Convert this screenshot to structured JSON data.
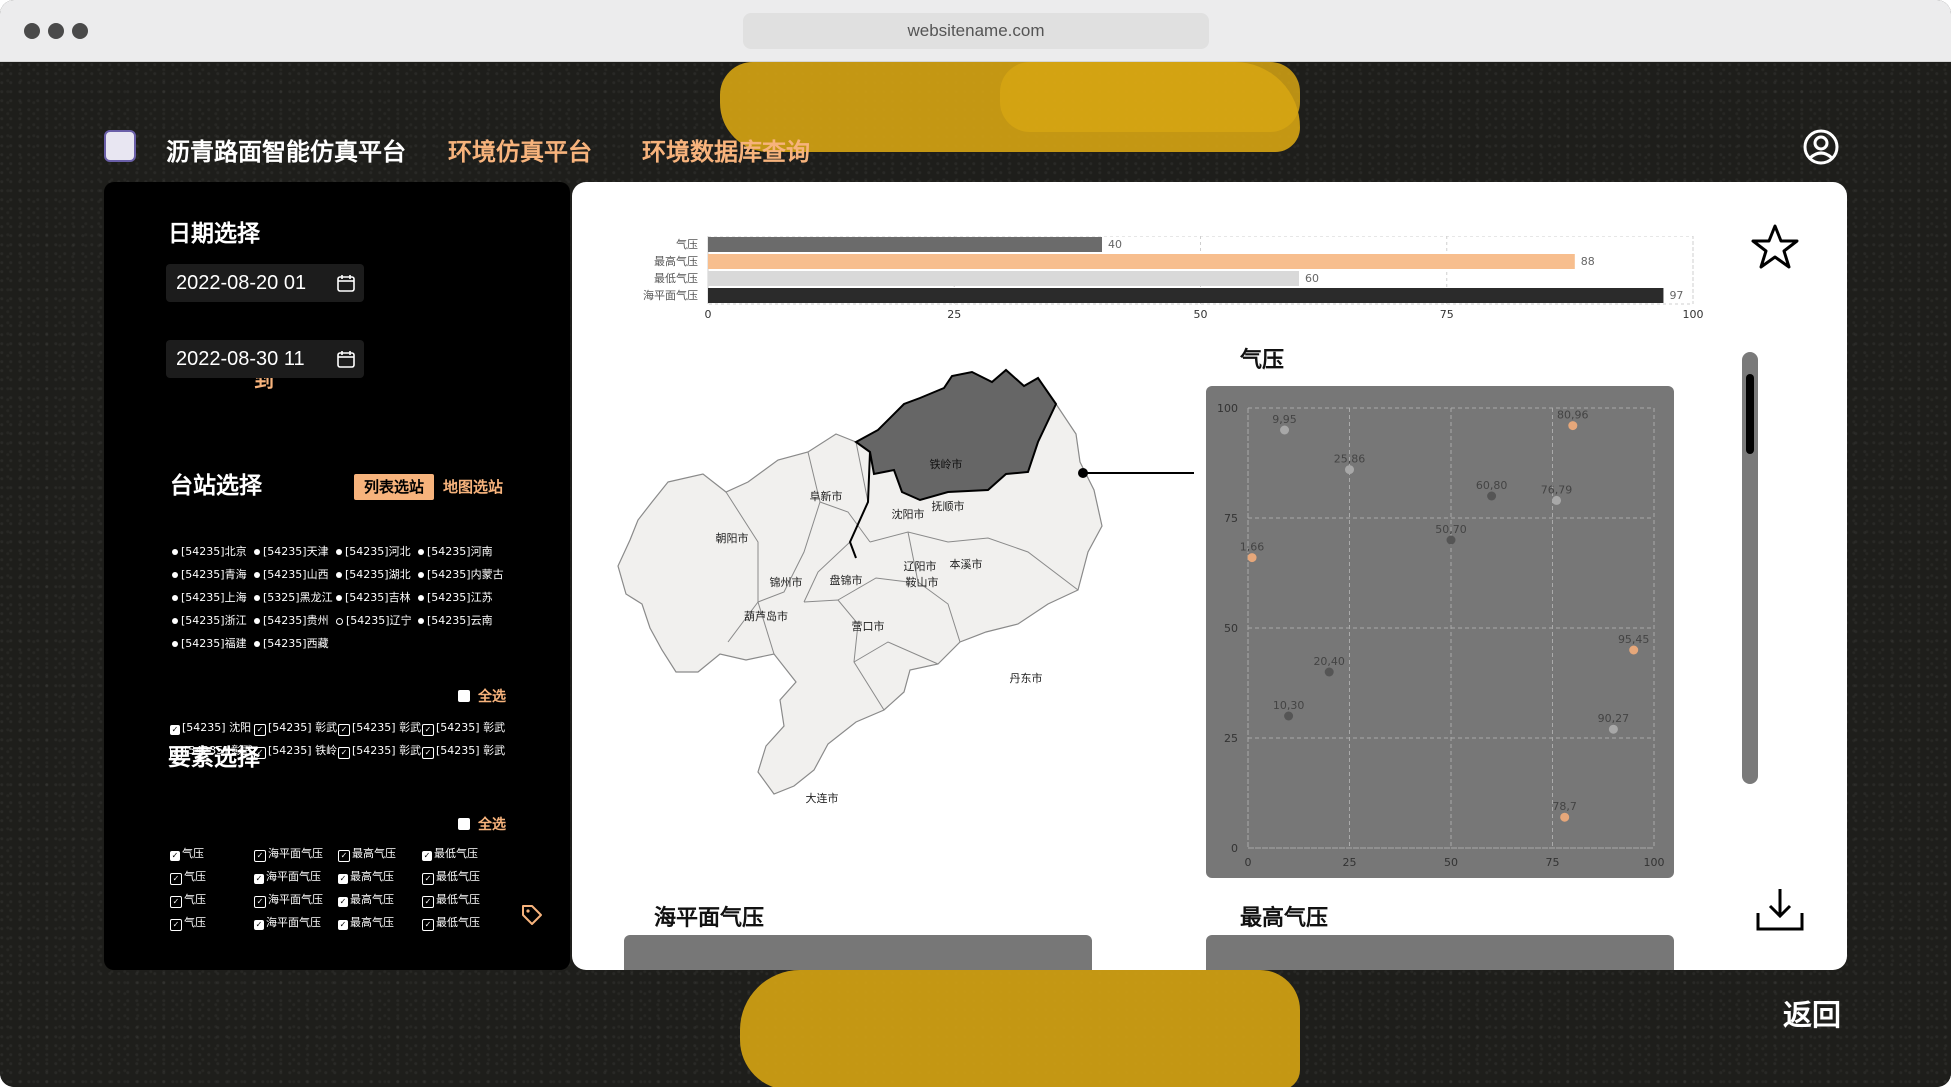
{
  "browser": {
    "url": "websitename.com"
  },
  "header": {
    "brand": "沥青路面智能仿真平台",
    "nav": [
      "环境仿真平台",
      "环境数据库查询"
    ]
  },
  "sidebar": {
    "date_title": "日期选择",
    "date_from": "2022-08-20 01",
    "date_to_label": "到",
    "date_to": "2022-08-30 11",
    "station_title": "台站选择",
    "tabs": [
      "列表选站",
      "地图选站"
    ],
    "stations": [
      "[54235]北京",
      "[54235]天津",
      "[54235]河北",
      "[54235]河南",
      "[54235]青海",
      "[54235]山西",
      "[54235]湖北",
      "[54235]内蒙古",
      "[54235]上海",
      "[5325]黑龙江",
      "[54235]吉林",
      "[54235]江苏",
      "[54235]浙江",
      "[54235]贵州",
      "[54235]辽宁",
      "[54235]云南",
      "[54235]福建",
      "[54235]西藏"
    ],
    "select_all": "全选",
    "chosen_stations": [
      "[54235] 沈阳",
      "[54235] 彰武",
      "[54235] 彰武",
      "[54235] 彰武",
      "[54235] 彰武",
      "[54235] 铁岭",
      "[54235] 彰武",
      "[54235] 彰武"
    ],
    "element_title": "要素选择",
    "elements": [
      "气压",
      "海平面气压",
      "最高气压",
      "最低气压",
      "气压",
      "海平面气压",
      "最高气压",
      "最低气压",
      "气压",
      "海平面气压",
      "最高气压",
      "最低气压",
      "气压",
      "海平面气压",
      "最高气压",
      "最低气压"
    ]
  },
  "main": {
    "scatter_title": "气压",
    "section_left": "海平面气压",
    "section_right": "最高气压",
    "back": "返回"
  },
  "map": {
    "cities": [
      "铁岭市",
      "阜新市",
      "沈阳市",
      "抚顺市",
      "朝阳市",
      "辽阳市",
      "本溪市",
      "锦州市",
      "盘锦市",
      "鞍山市",
      "葫芦岛市",
      "营口市",
      "丹东市",
      "大连市"
    ],
    "highlight": "铁岭市"
  },
  "chart_data": [
    {
      "type": "bar",
      "orientation": "horizontal",
      "categories": [
        "气压",
        "最高气压",
        "最低气压",
        "海平面气压"
      ],
      "values": [
        40,
        88,
        60,
        97
      ],
      "colors": [
        "#6b6b6b",
        "#f7be8e",
        "#d9d9d9",
        "#2b2b2b"
      ],
      "xlim": [
        0,
        100
      ],
      "xticks": [
        0,
        25,
        50,
        75,
        100
      ],
      "grid": true
    },
    {
      "type": "scatter",
      "title": "气压",
      "points": [
        {
          "x": 9,
          "y": 95,
          "label": "9,95",
          "color": "#a8a8a8"
        },
        {
          "x": 25,
          "y": 86,
          "label": "25,86",
          "color": "#a8a8a8"
        },
        {
          "x": 80,
          "y": 96,
          "label": "80,96",
          "color": "#e6a77a"
        },
        {
          "x": 60,
          "y": 80,
          "label": "60,80",
          "color": "#555555"
        },
        {
          "x": 76,
          "y": 79,
          "label": "76,79",
          "color": "#a8a8a8"
        },
        {
          "x": 50,
          "y": 70,
          "label": "50,70",
          "color": "#555555"
        },
        {
          "x": 1,
          "y": 66,
          "label": "1,66",
          "color": "#e6a77a"
        },
        {
          "x": 95,
          "y": 45,
          "label": "95,45",
          "color": "#e6a77a"
        },
        {
          "x": 20,
          "y": 40,
          "label": "20,40",
          "color": "#555555"
        },
        {
          "x": 10,
          "y": 30,
          "label": "10,30",
          "color": "#555555"
        },
        {
          "x": 90,
          "y": 27,
          "label": "90,27",
          "color": "#a8a8a8"
        },
        {
          "x": 78,
          "y": 7,
          "label": "78,7",
          "color": "#e6a77a"
        }
      ],
      "xlim": [
        0,
        100
      ],
      "ylim": [
        0,
        100
      ],
      "xticks": [
        0,
        25,
        50,
        75,
        100
      ],
      "yticks": [
        0,
        25,
        50,
        75,
        100
      ],
      "grid": true
    }
  ]
}
